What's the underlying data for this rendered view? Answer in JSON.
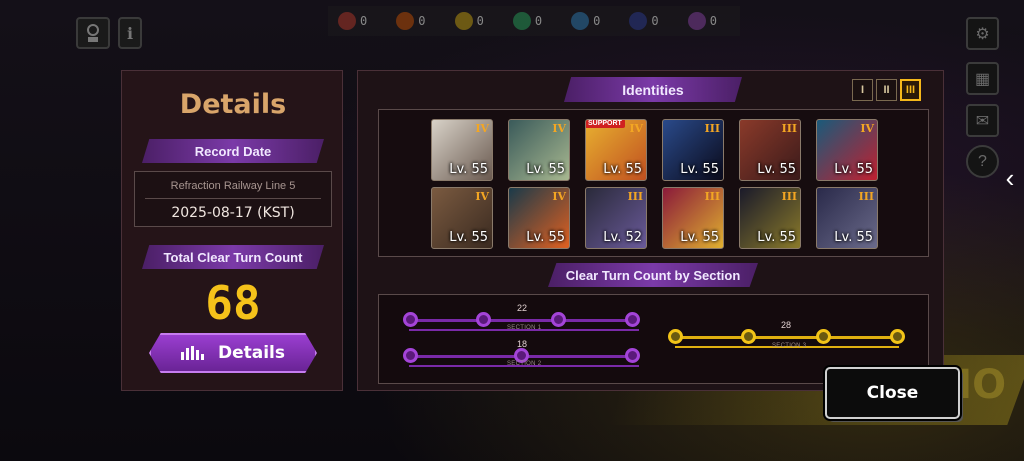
{
  "resources": [
    {
      "icon": "wrath-icon",
      "color": "#c0392b",
      "value": "0"
    },
    {
      "icon": "lust-icon",
      "color": "#d35400",
      "value": "0"
    },
    {
      "icon": "sloth-icon",
      "color": "#d4ac0d",
      "value": "0"
    },
    {
      "icon": "gluttony-icon",
      "color": "#27ae60",
      "value": "0"
    },
    {
      "icon": "gloom-icon",
      "color": "#2e86c1",
      "value": "0"
    },
    {
      "icon": "pride-icon",
      "color": "#2c3e9c",
      "value": "0"
    },
    {
      "icon": "envy-icon",
      "color": "#8e44ad",
      "value": "0"
    }
  ],
  "details_panel": {
    "title": "Details",
    "record_date_label": "Record Date",
    "location": "Refraction Railway Line 5",
    "date": "2025-08-17 (KST)",
    "total_label": "Total Clear Turn Count",
    "total_value": "68",
    "details_button": "Details"
  },
  "identities": {
    "label": "Identities",
    "tabs": [
      "I",
      "II",
      "III"
    ],
    "active_tab": "III",
    "cards": [
      {
        "rank": "IV",
        "level": "Lv. 55",
        "c1": "#d8d2c8",
        "c2": "#6a5a50"
      },
      {
        "rank": "IV",
        "level": "Lv. 55",
        "c1": "#3a5a5a",
        "c2": "#a8b890"
      },
      {
        "rank": "IV",
        "level": "Lv. 55",
        "c1": "#e8b030",
        "c2": "#c05020",
        "support": "SUPPORT"
      },
      {
        "rank": "III",
        "level": "Lv. 55",
        "c1": "#2a4a8a",
        "c2": "#0a0a1a"
      },
      {
        "rank": "III",
        "level": "Lv. 55",
        "c1": "#8a3a2a",
        "c2": "#3a1a1a"
      },
      {
        "rank": "IV",
        "level": "Lv. 55",
        "c1": "#1a5a7a",
        "c2": "#c02030"
      },
      {
        "rank": "IV",
        "level": "Lv. 55",
        "c1": "#7a5a40",
        "c2": "#3a2a20"
      },
      {
        "rank": "IV",
        "level": "Lv. 55",
        "c1": "#1a3a4a",
        "c2": "#e06020"
      },
      {
        "rank": "III",
        "level": "Lv. 52",
        "c1": "#2a2a3a",
        "c2": "#6a5a9a"
      },
      {
        "rank": "III",
        "level": "Lv. 55",
        "c1": "#8a1a3a",
        "c2": "#e0b030"
      },
      {
        "rank": "III",
        "level": "Lv. 55",
        "c1": "#1a1a2a",
        "c2": "#8a7a2a"
      },
      {
        "rank": "III",
        "level": "Lv. 55",
        "c1": "#2a2a4a",
        "c2": "#6a6a8a"
      }
    ]
  },
  "sections": {
    "label": "Clear Turn Count by Section",
    "list": [
      {
        "name": "SECTION 1",
        "turns": "22"
      },
      {
        "name": "SECTION 2",
        "turns": "18"
      },
      {
        "name": "SECTION 3",
        "turns": "28"
      }
    ]
  },
  "close_button": "Close"
}
